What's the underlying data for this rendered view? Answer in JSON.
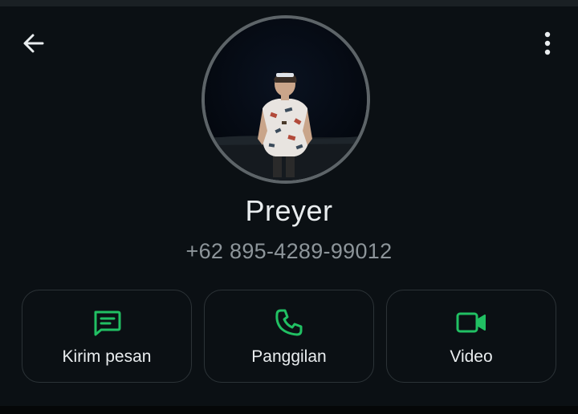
{
  "header": {
    "back_icon": "arrow-left-icon",
    "menu_icon": "more-vertical-icon"
  },
  "contact": {
    "name": "Preyer",
    "phone": "+62 895-4289-99012"
  },
  "actions": [
    {
      "label": "Kirim pesan",
      "icon": "message-icon"
    },
    {
      "label": "Panggilan",
      "icon": "phone-icon"
    },
    {
      "label": "Video",
      "icon": "video-camera-icon"
    }
  ],
  "colors": {
    "background": "#0b1014",
    "accent": "#21c063",
    "primary_text": "#e9edef",
    "secondary_text": "#8d959a",
    "card_border": "#2c3337"
  }
}
